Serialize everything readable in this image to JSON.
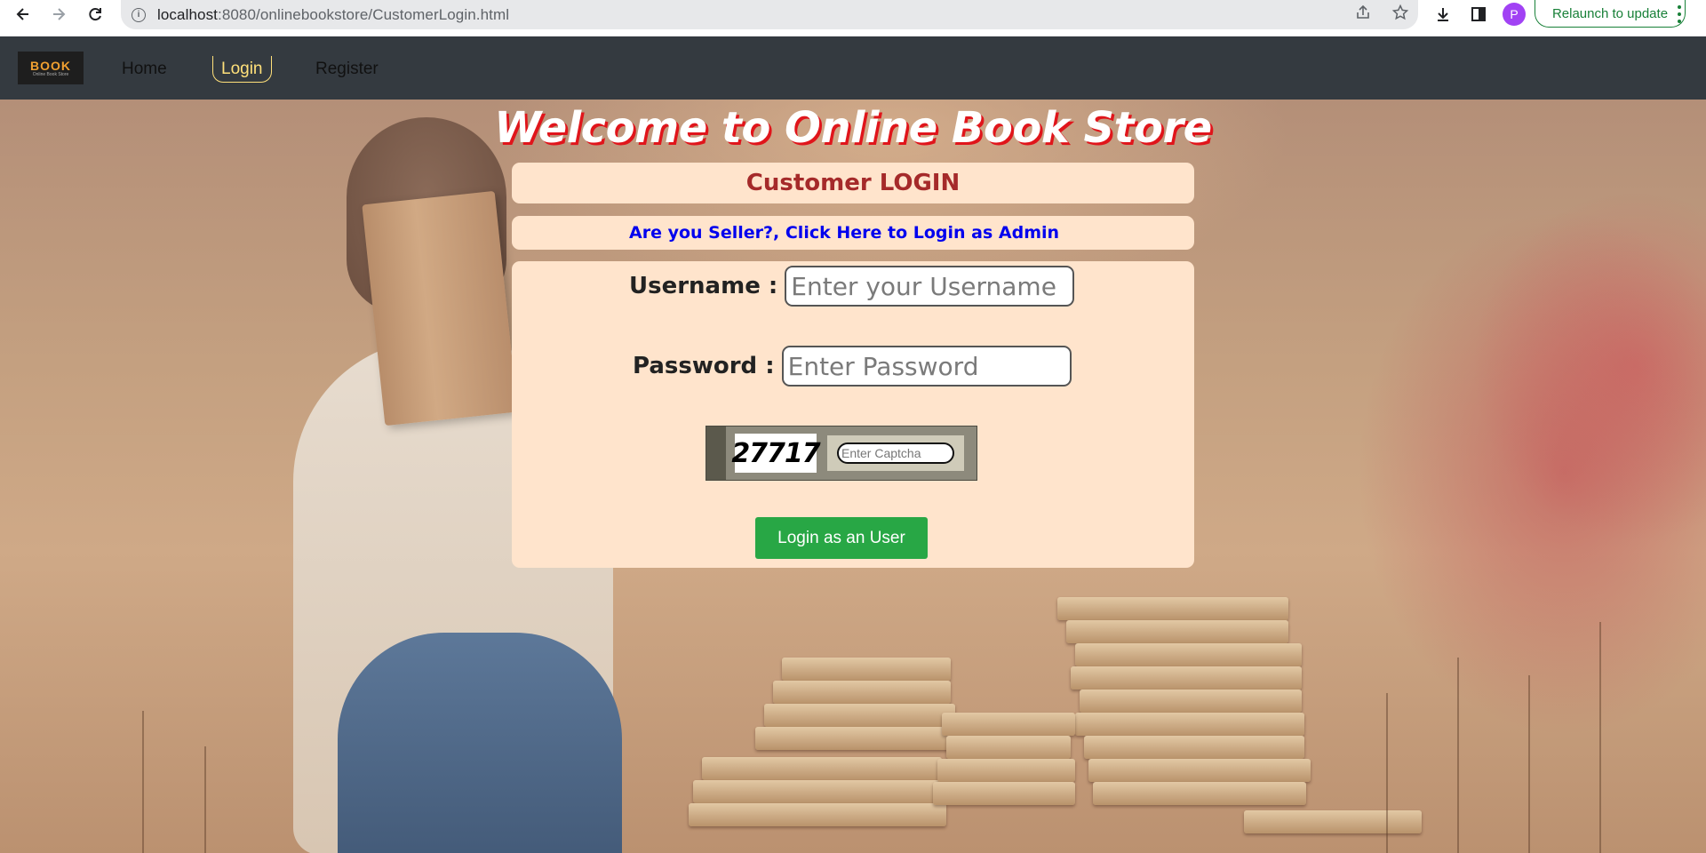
{
  "browser": {
    "url_host": "localhost",
    "url_path": ":8080/onlinebookstore/CustomerLogin.html",
    "profile_initial": "P",
    "relaunch_label": "Relaunch to update",
    "icons": [
      "back-icon",
      "forward-icon",
      "reload-icon",
      "info-icon",
      "share-icon",
      "star-icon",
      "download-icon",
      "side-panel-icon",
      "kebab-menu-icon"
    ]
  },
  "navbar": {
    "brand_text": "BOOK",
    "brand_sub": "Online Book Store",
    "links": [
      {
        "label": "Home"
      },
      {
        "label": "Login",
        "active": true
      },
      {
        "label": "Register"
      }
    ]
  },
  "page": {
    "welcome": "Welcome to Online Book Store",
    "form_title": "Customer LOGIN",
    "seller_link": "Are you Seller?, Click Here to Login as Admin",
    "username_label": "Username :",
    "username_placeholder": "Enter your Username",
    "password_label": "Password :",
    "password_placeholder": "Enter Password",
    "captcha_code": "27717",
    "captcha_placeholder": "Enter Captcha",
    "login_button": "Login as an User"
  },
  "colors": {
    "navbar_bg": "#343a40",
    "active_link": "#ffe07a",
    "panel_bg": "#ffe4cc",
    "title_color": "#a52a2a",
    "link_color": "#0000ee",
    "button_bg": "#28a745",
    "welcome_shadow": "#e0151b"
  }
}
